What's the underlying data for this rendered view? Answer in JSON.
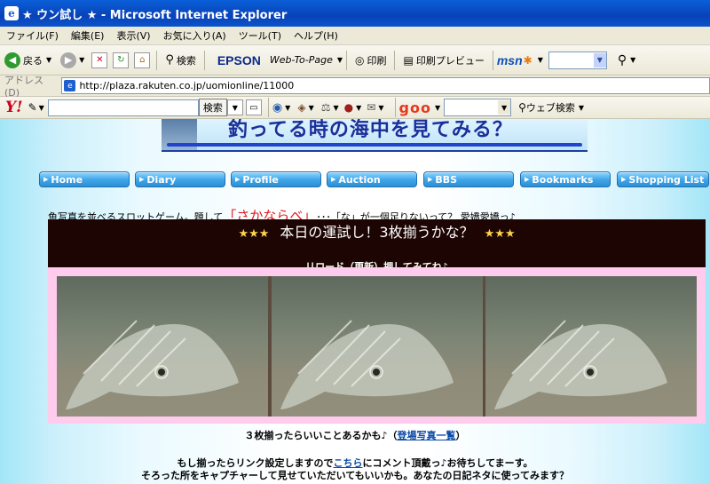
{
  "window": {
    "title": "★ ウン試し ★ - Microsoft Internet Explorer"
  },
  "menu": [
    "ファイル(F)",
    "編集(E)",
    "表示(V)",
    "お気に入り(A)",
    "ツール(T)",
    "ヘルプ(H)"
  ],
  "toolbar": {
    "back_label": "戻る",
    "search_label": "検索",
    "epson": "EPSON",
    "web_to_page": "Web-To-Page",
    "print_label": "印刷",
    "print_preview_label": "印刷プレビュー",
    "msn": "msn"
  },
  "address": {
    "label": "アドレス(D)",
    "url": "http://plaza.rakuten.co.jp/uomionline/11000"
  },
  "yahoo_bar": {
    "logo": "Y!",
    "search_button": "検索",
    "goo": "goo",
    "web_search": "ウェブ検索"
  },
  "banner": {
    "text": "釣ってる時の海中を見てみる？"
  },
  "nav": [
    "Home",
    "Diary",
    "Profile",
    "Auction",
    "BBS",
    "Bookmarks",
    "Shopping List"
  ],
  "intro": {
    "before": "魚写真を並べるスロットゲーム。題して",
    "highlight": "「さかならべ」",
    "after": "･･･「な」が一個足りないって？ 愛嬌愛嬌っ♪"
  },
  "slot": {
    "stars": "★★★",
    "title": "本日の運試し！3枚揃うかな？",
    "subtitle": "リロード（更新）押してみてね♪"
  },
  "caption": {
    "before": "３枚揃ったらいいことあるかも♪（",
    "link": "登場写真一覧",
    "after": "）"
  },
  "message": {
    "line1_before": "もし揃ったらリンク設定しますので",
    "line1_link": "こちら",
    "line1_after": "にコメント頂戴っ♪お待ちしてまーす。",
    "line2": "そろった所をキャプチャーして見せていただいてもいいかも。あなたの日記ネタに使ってみます？"
  }
}
